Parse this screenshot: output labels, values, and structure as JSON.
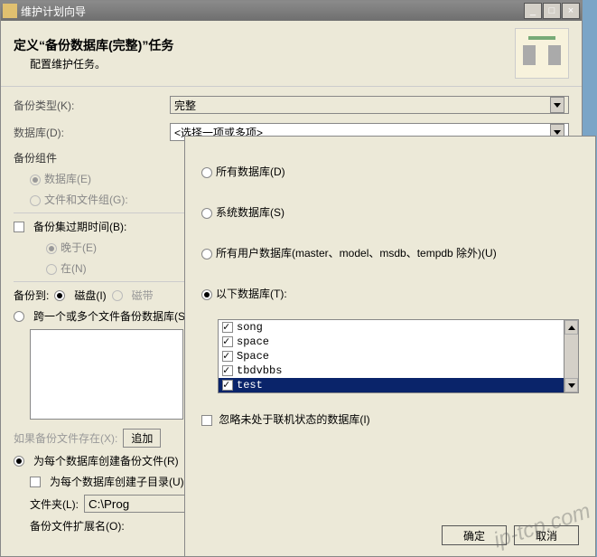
{
  "titlebar": {
    "title": "维护计划向导"
  },
  "header": {
    "title": "定义“备份数据库(完整)”任务",
    "subtitle": "配置维护任务。"
  },
  "form": {
    "backup_type_label": "备份类型(K):",
    "backup_type_value": "完整",
    "databases_label": "数据库(D):",
    "databases_value": "<选择一项或多项>",
    "component_title": "备份组件",
    "opt_database": "数据库(E)",
    "opt_filegroup": "文件和文件组(G):",
    "expiry_label": "备份集过期时间(B):",
    "expiry_after": "晚于(E)",
    "expiry_on": "在(N)",
    "backup_to": "备份到:",
    "backup_to_disk": "磁盘(I)",
    "backup_to_tape": "磁带",
    "across_files": "跨一个或多个文件备份数据库(S):",
    "if_exists_label": "如果备份文件存在(X):",
    "append_btn": "追加",
    "per_db_file": "为每个数据库创建备份文件(R)",
    "per_db_subdir": "为每个数据库创建子目录(U)",
    "folder_label": "文件夹(L):",
    "folder_value": "C:\\Prog",
    "ext_label": "备份文件扩展名(O):"
  },
  "popup": {
    "opt_all": "所有数据库(D)",
    "opt_system": "系统数据库(S)",
    "opt_user": "所有用户数据库(master、model、msdb、tempdb 除外)(U)",
    "opt_these": "以下数据库(T):",
    "items": [
      "song",
      "space",
      "Space",
      "tbdvbbs",
      "test"
    ],
    "ignore_offline": "忽略未处于联机状态的数据库(I)",
    "ok": "确定",
    "cancel": "取消"
  },
  "watermark": "ip-tcp.com"
}
